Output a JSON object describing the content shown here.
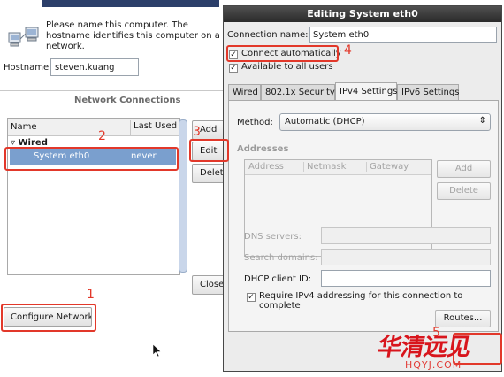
{
  "background_window": {
    "intro_text": "Please name this computer. The\nhostname identifies this computer on a\nnetwork.",
    "hostname_label": "Hostname:",
    "hostname_value": "steven.kuang",
    "network_connections_title": "Network Connections",
    "list": {
      "columns": [
        "Name",
        "Last Used"
      ],
      "group": "Wired",
      "rows": [
        {
          "name": "System eth0",
          "last_used": "never"
        }
      ]
    },
    "buttons": {
      "add": "Add",
      "edit": "Edit",
      "delete": "Delete",
      "close": "Close",
      "configure_network": "Configure Network"
    }
  },
  "annotations": [
    "1",
    "2",
    "3",
    "4",
    "5"
  ],
  "dialog": {
    "title": "Editing System eth0",
    "connection_name_label": "Connection name:",
    "connection_name_value": "System eth0",
    "connect_automatically": {
      "label": "Connect automatically",
      "checked": true
    },
    "available_all_users": {
      "label": "Available to all users",
      "checked": true
    },
    "tabs": [
      "Wired",
      "802.1x Security",
      "IPv4 Settings",
      "IPv6 Settings"
    ],
    "active_tab": "IPv4 Settings",
    "method_label": "Method:",
    "method_value": "Automatic (DHCP)",
    "addresses_label": "Addresses",
    "address_columns": [
      "Address",
      "Netmask",
      "Gateway"
    ],
    "add_label": "Add",
    "delete_label": "Delete",
    "dns_label": "DNS servers:",
    "search_label": "Search domains:",
    "dhcp_label": "DHCP client ID:",
    "require_ipv4": {
      "label": "Require IPv4 addressing for this connection to complete",
      "checked": true
    },
    "routes_label": "Routes..."
  },
  "watermark": {
    "main": "华清远见",
    "sub": "HQYJ.COM"
  },
  "colors": {
    "annotation": "#e2382a",
    "selection": "#7a9fce",
    "titlebar": "#2b2b2b"
  }
}
